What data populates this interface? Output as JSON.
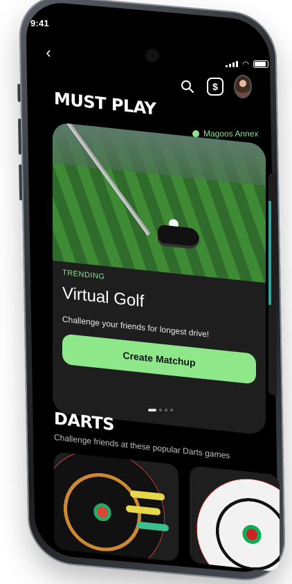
{
  "status_bar": {
    "time": "9:41"
  },
  "header": {
    "title": "MUST PLAY",
    "search_icon": "search-icon",
    "wallet_icon": "dollar-icon",
    "wallet_symbol": "$",
    "profile": "avatar"
  },
  "location": {
    "name": "Magoos Annex",
    "icon": "location-pin-icon"
  },
  "featured_card": {
    "tag": "TRENDING",
    "title": "Virtual Golf",
    "description": "Challenge your friends for longest drive!",
    "button_label": "Create Matchup"
  },
  "pager": {
    "count": 4,
    "active_index": 0
  },
  "darts_section": {
    "title": "DARTS",
    "subtitle": "Challenge friends at these popular Darts games"
  },
  "colors": {
    "accent": "#8ee88a",
    "background": "#000000",
    "card": "#1e1e1e",
    "text": "#ffffff"
  }
}
